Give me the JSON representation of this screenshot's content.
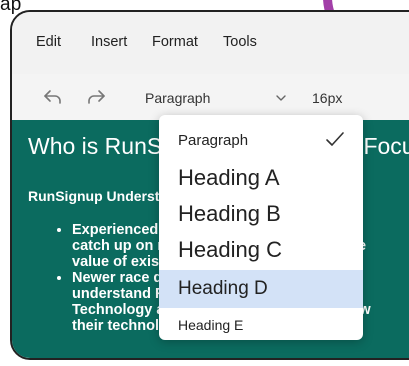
{
  "top_fragment": "ap",
  "menubar": {
    "items": [
      "Edit",
      "Insert",
      "Format",
      "Tools"
    ]
  },
  "toolbar": {
    "block_style_value": "Paragraph",
    "font_size_value": "16px"
  },
  "content": {
    "heading": "Who is RunSignup's Community Focus?",
    "lead": "RunSignup Understands",
    "bullets": [
      "Experienced race directors looking to",
      "catch up on new technology and maximize",
      "value of existing investment.",
      "Newer race directors who have",
      "understand RunSignup and RunSignup",
      "Technology and Community to use the new",
      "their technology."
    ]
  },
  "dropdown": {
    "options": [
      "Paragraph",
      "Heading A",
      "Heading B",
      "Heading C",
      "Heading D",
      "Heading E"
    ],
    "selected": "Paragraph",
    "highlighted": "Heading D"
  },
  "colors": {
    "content_bg": "#0b6b5f",
    "highlight_bg": "#d3e2f7",
    "accent_arc": "#a23fa8"
  },
  "icons": [
    "undo-icon",
    "redo-icon",
    "chevron-down-icon",
    "checkmark-icon"
  ]
}
